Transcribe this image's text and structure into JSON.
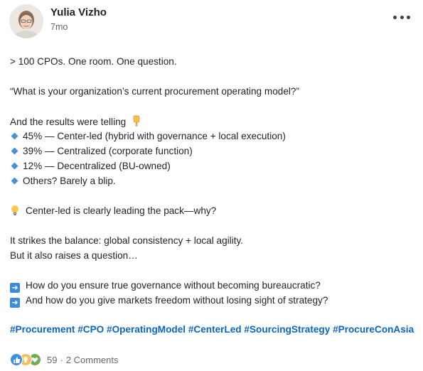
{
  "post": {
    "author": "Yulia Vizho",
    "time": "7mo",
    "body": {
      "intro": "> 100 CPOs. One room. One question.",
      "question": "“What is your organization’s current procurement operating model?”",
      "results_intro": "And the results were telling",
      "results": [
        "45% — Center-led (hybrid with governance + local execution)",
        "39% — Centralized (corporate function)",
        "12% — Decentralized (BU-owned)",
        "Others? Barely a blip."
      ],
      "insight": "Center-led is clearly leading the pack—why?",
      "balance_1": "It strikes the balance: global consistency + local agility.",
      "balance_2": "But it also raises a question…",
      "prompts": [
        "How do you ensure true governance without becoming bureaucratic?",
        "And how do you give markets freedom without losing sight of strategy?"
      ]
    },
    "hashtags": [
      "#Procurement",
      "#CPO",
      "#OperatingModel",
      "#CenterLed",
      "#SourcingStrategy",
      "#ProcureConAsia"
    ],
    "social": {
      "reactions_count": "59",
      "separator": "·",
      "comments": "2 Comments",
      "reaction_icons": [
        "like-icon",
        "insightful-icon",
        "support-icon"
      ]
    }
  },
  "colors": {
    "hashtag": "#0a66c2",
    "text": "#1d2226",
    "muted": "#666666",
    "bullet": "#4a90d9"
  }
}
